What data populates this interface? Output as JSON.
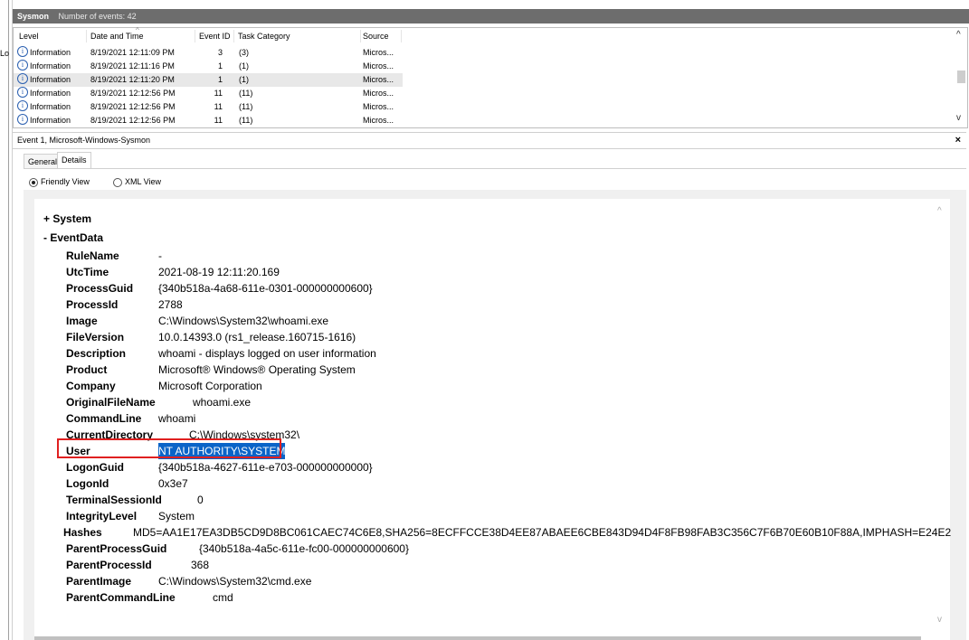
{
  "left_strip": {
    "label": "Lo"
  },
  "header": {
    "log_name": "Sysmon",
    "event_count": "Number of events: 42"
  },
  "columns": [
    "Level",
    "Date and Time",
    "Event ID",
    "Task Category",
    "Source"
  ],
  "events": [
    {
      "level": "Information",
      "datetime": "8/19/2021 12:11:09 PM",
      "id": "3",
      "category": "(3)",
      "source": "Micros..."
    },
    {
      "level": "Information",
      "datetime": "8/19/2021 12:11:16 PM",
      "id": "1",
      "category": "(1)",
      "source": "Micros..."
    },
    {
      "level": "Information",
      "datetime": "8/19/2021 12:11:20 PM",
      "id": "1",
      "category": "(1)",
      "source": "Micros...",
      "selected": true
    },
    {
      "level": "Information",
      "datetime": "8/19/2021 12:12:56 PM",
      "id": "11",
      "category": "(11)",
      "source": "Micros..."
    },
    {
      "level": "Information",
      "datetime": "8/19/2021 12:12:56 PM",
      "id": "11",
      "category": "(11)",
      "source": "Micros..."
    },
    {
      "level": "Information",
      "datetime": "8/19/2021 12:12:56 PM",
      "id": "11",
      "category": "(11)",
      "source": "Micros..."
    }
  ],
  "detail": {
    "title": "Event 1, Microsoft-Windows-Sysmon",
    "close": "×",
    "tabs": [
      "General",
      "Details"
    ],
    "views": [
      "Friendly View",
      "XML View"
    ],
    "tree_system": "+  System",
    "tree_eventdata": "-  EventData",
    "fields": [
      {
        "k": "RuleName",
        "v": "-"
      },
      {
        "k": "UtcTime",
        "v": "2021-08-19 12:11:20.169"
      },
      {
        "k": "ProcessGuid",
        "v": "{340b518a-4a68-611e-0301-000000000600}"
      },
      {
        "k": "ProcessId",
        "v": "2788"
      },
      {
        "k": "Image",
        "v": "C:\\Windows\\System32\\whoami.exe"
      },
      {
        "k": "FileVersion",
        "v": "10.0.14393.0 (rs1_release.160715-1616)"
      },
      {
        "k": "Description",
        "v": "whoami - displays logged on user information"
      },
      {
        "k": "Product",
        "v": "Microsoft® Windows® Operating System"
      },
      {
        "k": "Company",
        "v": "Microsoft Corporation"
      },
      {
        "k": "OriginalFileName",
        "v": "whoami.exe"
      },
      {
        "k": "CommandLine",
        "v": "whoami"
      },
      {
        "k": "CurrentDirectory",
        "v": "C:\\Windows\\system32\\"
      },
      {
        "k": "User",
        "v": "NT AUTHORITY\\SYSTEM"
      },
      {
        "k": "LogonGuid",
        "v": "{340b518a-4627-611e-e703-000000000000}"
      },
      {
        "k": "LogonId",
        "v": "0x3e7"
      },
      {
        "k": "TerminalSessionId",
        "v": "0"
      },
      {
        "k": "IntegrityLevel",
        "v": "System"
      },
      {
        "k": "Hashes",
        "v": "MD5=AA1E17EA3DB5CD9D8BC061CAEC74C6E8,SHA256=8ECFFCCE38D4EE87ABAEE6CBE843D94D4F8FB98FAB3C356C7F6B70E60B10F88A,IMPHASH=E24E2"
      },
      {
        "k": "ParentProcessGuid",
        "v": "{340b518a-4a5c-611e-fc00-000000000600}"
      },
      {
        "k": "ParentProcessId",
        "v": "368"
      },
      {
        "k": "ParentImage",
        "v": "C:\\Windows\\System32\\cmd.exe"
      },
      {
        "k": "ParentCommandLine",
        "v": "cmd"
      }
    ]
  },
  "icons": {
    "info": "i",
    "sort_up": "^",
    "scroll_up": "^",
    "scroll_down": "v"
  }
}
